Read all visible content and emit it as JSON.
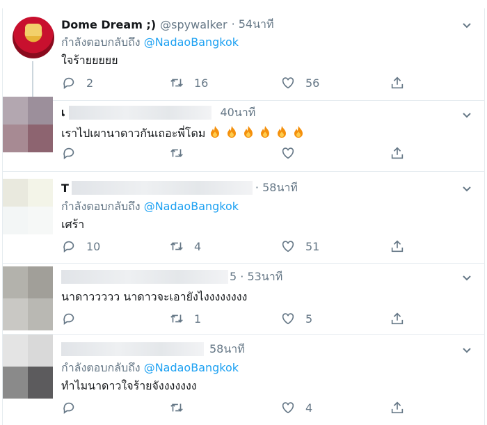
{
  "tweets": [
    {
      "name": "Dome Dream ;)",
      "handle": "@spywalker",
      "time": "· 54นาที",
      "reply_prefix": "กำลังตอบกลับถึง",
      "reply_handle": "@NadaoBangkok",
      "text": "ใจร้ายยยยย",
      "replies": "2",
      "retweets": "16",
      "likes": "56"
    },
    {
      "name": "เ",
      "time": "40นาที",
      "text": "เราไปเผานาดาวกันเถอะพี่โดม",
      "emoji": [
        "fire",
        "fire",
        "fire",
        "fire",
        "fire",
        "fire"
      ]
    },
    {
      "name": "T",
      "time": "· 58นาที",
      "reply_prefix": "กำลังตอบกลับถึง",
      "reply_handle": "@NadaoBangkok",
      "text": "เศร้า",
      "replies": "10",
      "retweets": "4",
      "likes": "51"
    },
    {
      "time": "5 · 53นาที",
      "text": "นาดาววววว นาดาวจะเอายังไงงงงงงงง",
      "retweets": "1",
      "likes": "5"
    },
    {
      "time": "58นาที",
      "reply_prefix": "กำลังตอบกลับถึง",
      "reply_handle": "@NadaoBangkok",
      "text": "ทำไมนาดาวใจร้ายจังงงงงงง",
      "likes": "4"
    }
  ],
  "icons": {
    "reply": "reply-icon",
    "retweet": "retweet-icon",
    "like": "heart-icon",
    "share": "share-icon",
    "menu": "chevron-down-icon"
  },
  "colors": {
    "link": "#1da1f2",
    "muted": "#657786",
    "text": "#14171a",
    "border": "#e6ecf0"
  }
}
